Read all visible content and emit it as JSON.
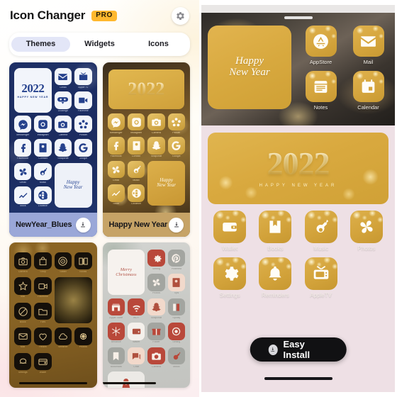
{
  "app": {
    "title": "Icon Changer",
    "pro_badge": "PRO",
    "settings_icon": "gear-icon"
  },
  "tabs": [
    {
      "label": "Themes",
      "active": true
    },
    {
      "label": "Widgets",
      "active": false
    },
    {
      "label": "Icons",
      "active": false
    }
  ],
  "themes": [
    {
      "name": "NewYear_Blues",
      "style": "blue",
      "download_icon": "download-icon",
      "banner_year": "2022",
      "banner_sub": "HAPPY NEW YEAR",
      "tile_text_line1": "Happy",
      "tile_text_line2": "New Year",
      "icons": [
        {
          "label": "Gmail",
          "icon": "mail-icon"
        },
        {
          "label": "Apple Tv",
          "icon": "tv-icon"
        },
        {
          "label": "Duolingo",
          "icon": "owl-icon"
        },
        {
          "label": "Facetime",
          "icon": "video-icon"
        },
        {
          "label": "Messenger",
          "icon": "messenger-icon"
        },
        {
          "label": "Instagram",
          "icon": "instagram-icon"
        },
        {
          "label": "Camera",
          "icon": "camera-icon"
        },
        {
          "label": "Picsart",
          "icon": "picsart-icon"
        },
        {
          "label": "Facebook",
          "icon": "facebook-icon"
        },
        {
          "label": "Contact",
          "icon": "contact-icon"
        },
        {
          "label": "Snapchat",
          "icon": "snapchat-icon"
        },
        {
          "label": "Google",
          "icon": "google-icon"
        },
        {
          "label": "Gmail",
          "icon": "pinwheel-icon"
        },
        {
          "label": "Music",
          "icon": "guitar-icon"
        },
        {
          "label": "Stock",
          "icon": "chart-icon"
        },
        {
          "label": "Location",
          "icon": "globe-pin-icon"
        }
      ]
    },
    {
      "name": "Happy New Year",
      "style": "gold",
      "download_icon": "download-icon",
      "banner_year": "2022",
      "tile_text_line1": "Happy",
      "tile_text_line2": "New Year",
      "icons": [
        {
          "label": "Messenger",
          "icon": "messenger-icon"
        },
        {
          "label": "Instagram",
          "icon": "instagram-icon"
        },
        {
          "label": "Camera",
          "icon": "camera-icon"
        },
        {
          "label": "Picsart",
          "icon": "picsart-icon"
        },
        {
          "label": "Facebook",
          "icon": "facebook-icon"
        },
        {
          "label": "Contact",
          "icon": "contact-icon"
        },
        {
          "label": "Snapchat",
          "icon": "snapchat-icon"
        },
        {
          "label": "Google",
          "icon": "google-icon"
        },
        {
          "label": "Gmail",
          "icon": "pinwheel-icon"
        },
        {
          "label": "Music",
          "icon": "guitar-icon"
        },
        {
          "label": "Stock",
          "icon": "chart-icon"
        },
        {
          "label": "Location",
          "icon": "globe-pin-icon"
        }
      ]
    },
    {
      "name": "",
      "style": "brown",
      "icons": [
        {
          "label": "Camera",
          "icon": "camera-icon"
        },
        {
          "label": "Shop",
          "icon": "bag-icon"
        },
        {
          "label": "Safari",
          "icon": "compass-icon"
        },
        {
          "label": "Books",
          "icon": "book-icon"
        },
        {
          "label": "Star",
          "icon": "star-icon"
        },
        {
          "label": "Facetime",
          "icon": "video-icon"
        },
        {
          "label": "Block",
          "icon": "no-entry-icon"
        },
        {
          "label": "Files",
          "icon": "folder-icon"
        },
        {
          "label": "Mail",
          "icon": "mail-icon"
        },
        {
          "label": "Health",
          "icon": "heart-icon"
        },
        {
          "label": "Weather",
          "icon": "cloud-icon"
        },
        {
          "label": "Photos",
          "icon": "flower-icon"
        },
        {
          "label": "Settings",
          "icon": "rings-icon"
        },
        {
          "label": "Wallet",
          "icon": "wallet-icon"
        }
      ]
    },
    {
      "name": "",
      "style": "xmas",
      "tile_text_line1": "Merry",
      "tile_text_line2": "Christmass",
      "icons": [
        {
          "label": "Setting",
          "icon": "gear-icon"
        },
        {
          "label": "Pinterest",
          "icon": "pinterest-icon"
        },
        {
          "label": "Photos",
          "icon": "pinwheel-icon"
        },
        {
          "label": "Tips",
          "icon": "contact-icon"
        },
        {
          "label": "Apple Store",
          "icon": "store-icon"
        },
        {
          "label": "Wi-Fi",
          "icon": "wifi-icon"
        },
        {
          "label": "Snapchat",
          "icon": "snapchat-icon"
        },
        {
          "label": "Spotify",
          "icon": "book-icon"
        },
        {
          "label": "Behance",
          "icon": "snowflake-icon"
        },
        {
          "label": "Wallet",
          "icon": "wallet-icon"
        },
        {
          "label": "Folder",
          "icon": "gift-icon"
        },
        {
          "label": "Setting",
          "icon": "target-icon"
        },
        {
          "label": "Bookmark",
          "icon": "bookmark-icon"
        },
        {
          "label": "Chat",
          "icon": "chat-icon"
        },
        {
          "label": "Camera",
          "icon": "camera-icon"
        },
        {
          "label": "Music",
          "icon": "guitar-icon"
        }
      ]
    }
  ],
  "preview": {
    "widget": {
      "text_line1": "Happy",
      "text_line2": "New Year"
    },
    "wallpaper_apps": [
      {
        "label": "AppStore",
        "icon": "appstore-icon"
      },
      {
        "label": "Mail",
        "icon": "mail-icon"
      },
      {
        "label": "Notes",
        "icon": "notes-icon"
      },
      {
        "label": "Calendar",
        "icon": "calendar-icon"
      }
    ],
    "banner": {
      "year": "2022",
      "subtitle": "HAPPY NEW YEAR"
    },
    "home_apps": [
      {
        "label": "Wallet",
        "icon": "wallet-icon"
      },
      {
        "label": "Books",
        "icon": "book-icon"
      },
      {
        "label": "Music",
        "icon": "guitar-icon"
      },
      {
        "label": "Photos",
        "icon": "pinwheel-icon"
      },
      {
        "label": "Settings",
        "icon": "gear-icon"
      },
      {
        "label": "Reminders",
        "icon": "bell-icon"
      },
      {
        "label": "AppleTV",
        "icon": "tv-icon"
      }
    ],
    "install_button": {
      "label": "Easy Install",
      "icon": "download-icon"
    }
  }
}
